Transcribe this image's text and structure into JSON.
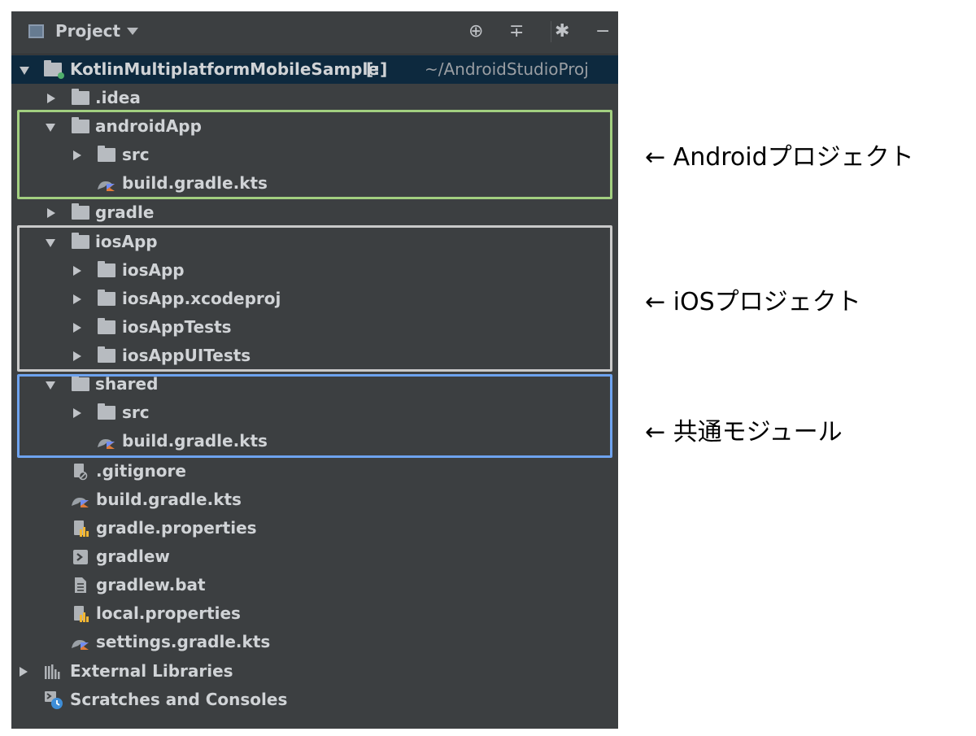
{
  "header": {
    "title": "Project",
    "locate_icon": "crosshair-icon",
    "collapse_icon": "collapse-all-icon",
    "settings_icon": "gear-icon",
    "hide_icon": "minus-icon"
  },
  "tree": {
    "root": {
      "name": "KotlinMultiplatformMobileSample",
      "tag": "[:]",
      "path": "~/AndroidStudioProj"
    },
    "items": [
      {
        "label": ".idea",
        "icon": "folder-icon",
        "expanded": false
      },
      {
        "label": "androidApp",
        "icon": "module-folder-icon",
        "expanded": true
      },
      {
        "label": "src",
        "icon": "folder-icon",
        "expanded": false
      },
      {
        "label": "build.gradle.kts",
        "icon": "gradle-kotlin-icon"
      },
      {
        "label": "gradle",
        "icon": "folder-icon",
        "expanded": false
      },
      {
        "label": "iosApp",
        "icon": "folder-icon",
        "expanded": true
      },
      {
        "label": "iosApp",
        "icon": "folder-icon",
        "expanded": false
      },
      {
        "label": "iosApp.xcodeproj",
        "icon": "folder-icon",
        "expanded": false
      },
      {
        "label": "iosAppTests",
        "icon": "folder-icon",
        "expanded": false
      },
      {
        "label": "iosAppUITests",
        "icon": "folder-icon",
        "expanded": false
      },
      {
        "label": "shared",
        "icon": "module-folder-icon",
        "expanded": true
      },
      {
        "label": "src",
        "icon": "folder-icon",
        "expanded": false
      },
      {
        "label": "build.gradle.kts",
        "icon": "gradle-kotlin-icon"
      },
      {
        "label": ".gitignore",
        "icon": "ignore-file-icon"
      },
      {
        "label": "build.gradle.kts",
        "icon": "gradle-kotlin-icon"
      },
      {
        "label": "gradle.properties",
        "icon": "properties-file-icon"
      },
      {
        "label": "gradlew",
        "icon": "shell-script-icon"
      },
      {
        "label": "gradlew.bat",
        "icon": "text-file-icon"
      },
      {
        "label": "local.properties",
        "icon": "properties-file-icon"
      },
      {
        "label": "settings.gradle.kts",
        "icon": "gradle-kotlin-icon"
      },
      {
        "label": "External Libraries",
        "icon": "library-icon",
        "expanded": false
      },
      {
        "label": "Scratches and Consoles",
        "icon": "scratches-icon"
      }
    ]
  },
  "annotations": {
    "android": "← Androidプロジェクト",
    "ios": "← iOSプロジェクト",
    "shared": "← 共通モジュール"
  },
  "colors": {
    "android_box": "#a2cf80",
    "ios_box": "#c9c9c9",
    "shared_box": "#6ea3ef",
    "panel_bg": "#3c3f41",
    "selected_row": "#0d293e"
  }
}
